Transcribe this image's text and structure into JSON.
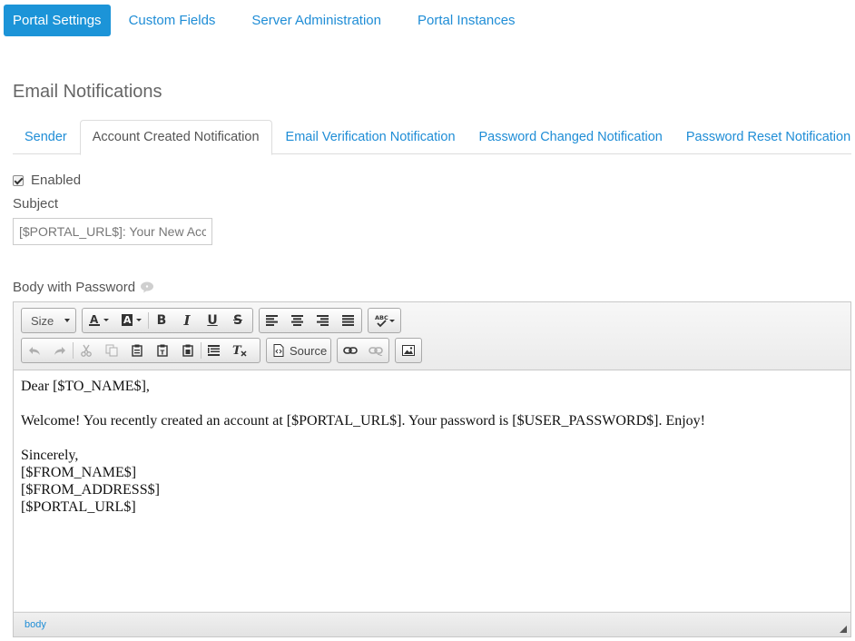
{
  "topnav": {
    "items": [
      {
        "label": "Portal Settings",
        "active": true
      },
      {
        "label": "Custom Fields",
        "active": false
      },
      {
        "label": "Server Administration",
        "active": false
      },
      {
        "label": "Portal Instances",
        "active": false
      }
    ]
  },
  "section": {
    "title": "Email Notifications"
  },
  "tabs": [
    {
      "label": "Sender",
      "active": false
    },
    {
      "label": "Account Created Notification",
      "active": true
    },
    {
      "label": "Email Verification Notification",
      "active": false
    },
    {
      "label": "Password Changed Notification",
      "active": false
    },
    {
      "label": "Password Reset Notification",
      "active": false
    }
  ],
  "form": {
    "enabled_label": "Enabled",
    "enabled_checked": true,
    "subject_label": "Subject",
    "subject_value": "[$PORTAL_URL$]: Your New Account",
    "body_label": "Body with Password"
  },
  "editor": {
    "size_label": "Size",
    "source_label": "Source",
    "content": {
      "line1": "Dear [$TO_NAME$],",
      "line2": "Welcome! You recently created an account at [$PORTAL_URL$]. Your password is [$USER_PASSWORD$]. Enjoy!",
      "line3": "Sincerely,",
      "line4": "[$FROM_NAME$]",
      "line5": "[$FROM_ADDRESS$]",
      "line6": "[$PORTAL_URL$]"
    },
    "path": "body"
  },
  "colors": {
    "accent": "#1c94d8",
    "link": "#1f8dd6"
  }
}
